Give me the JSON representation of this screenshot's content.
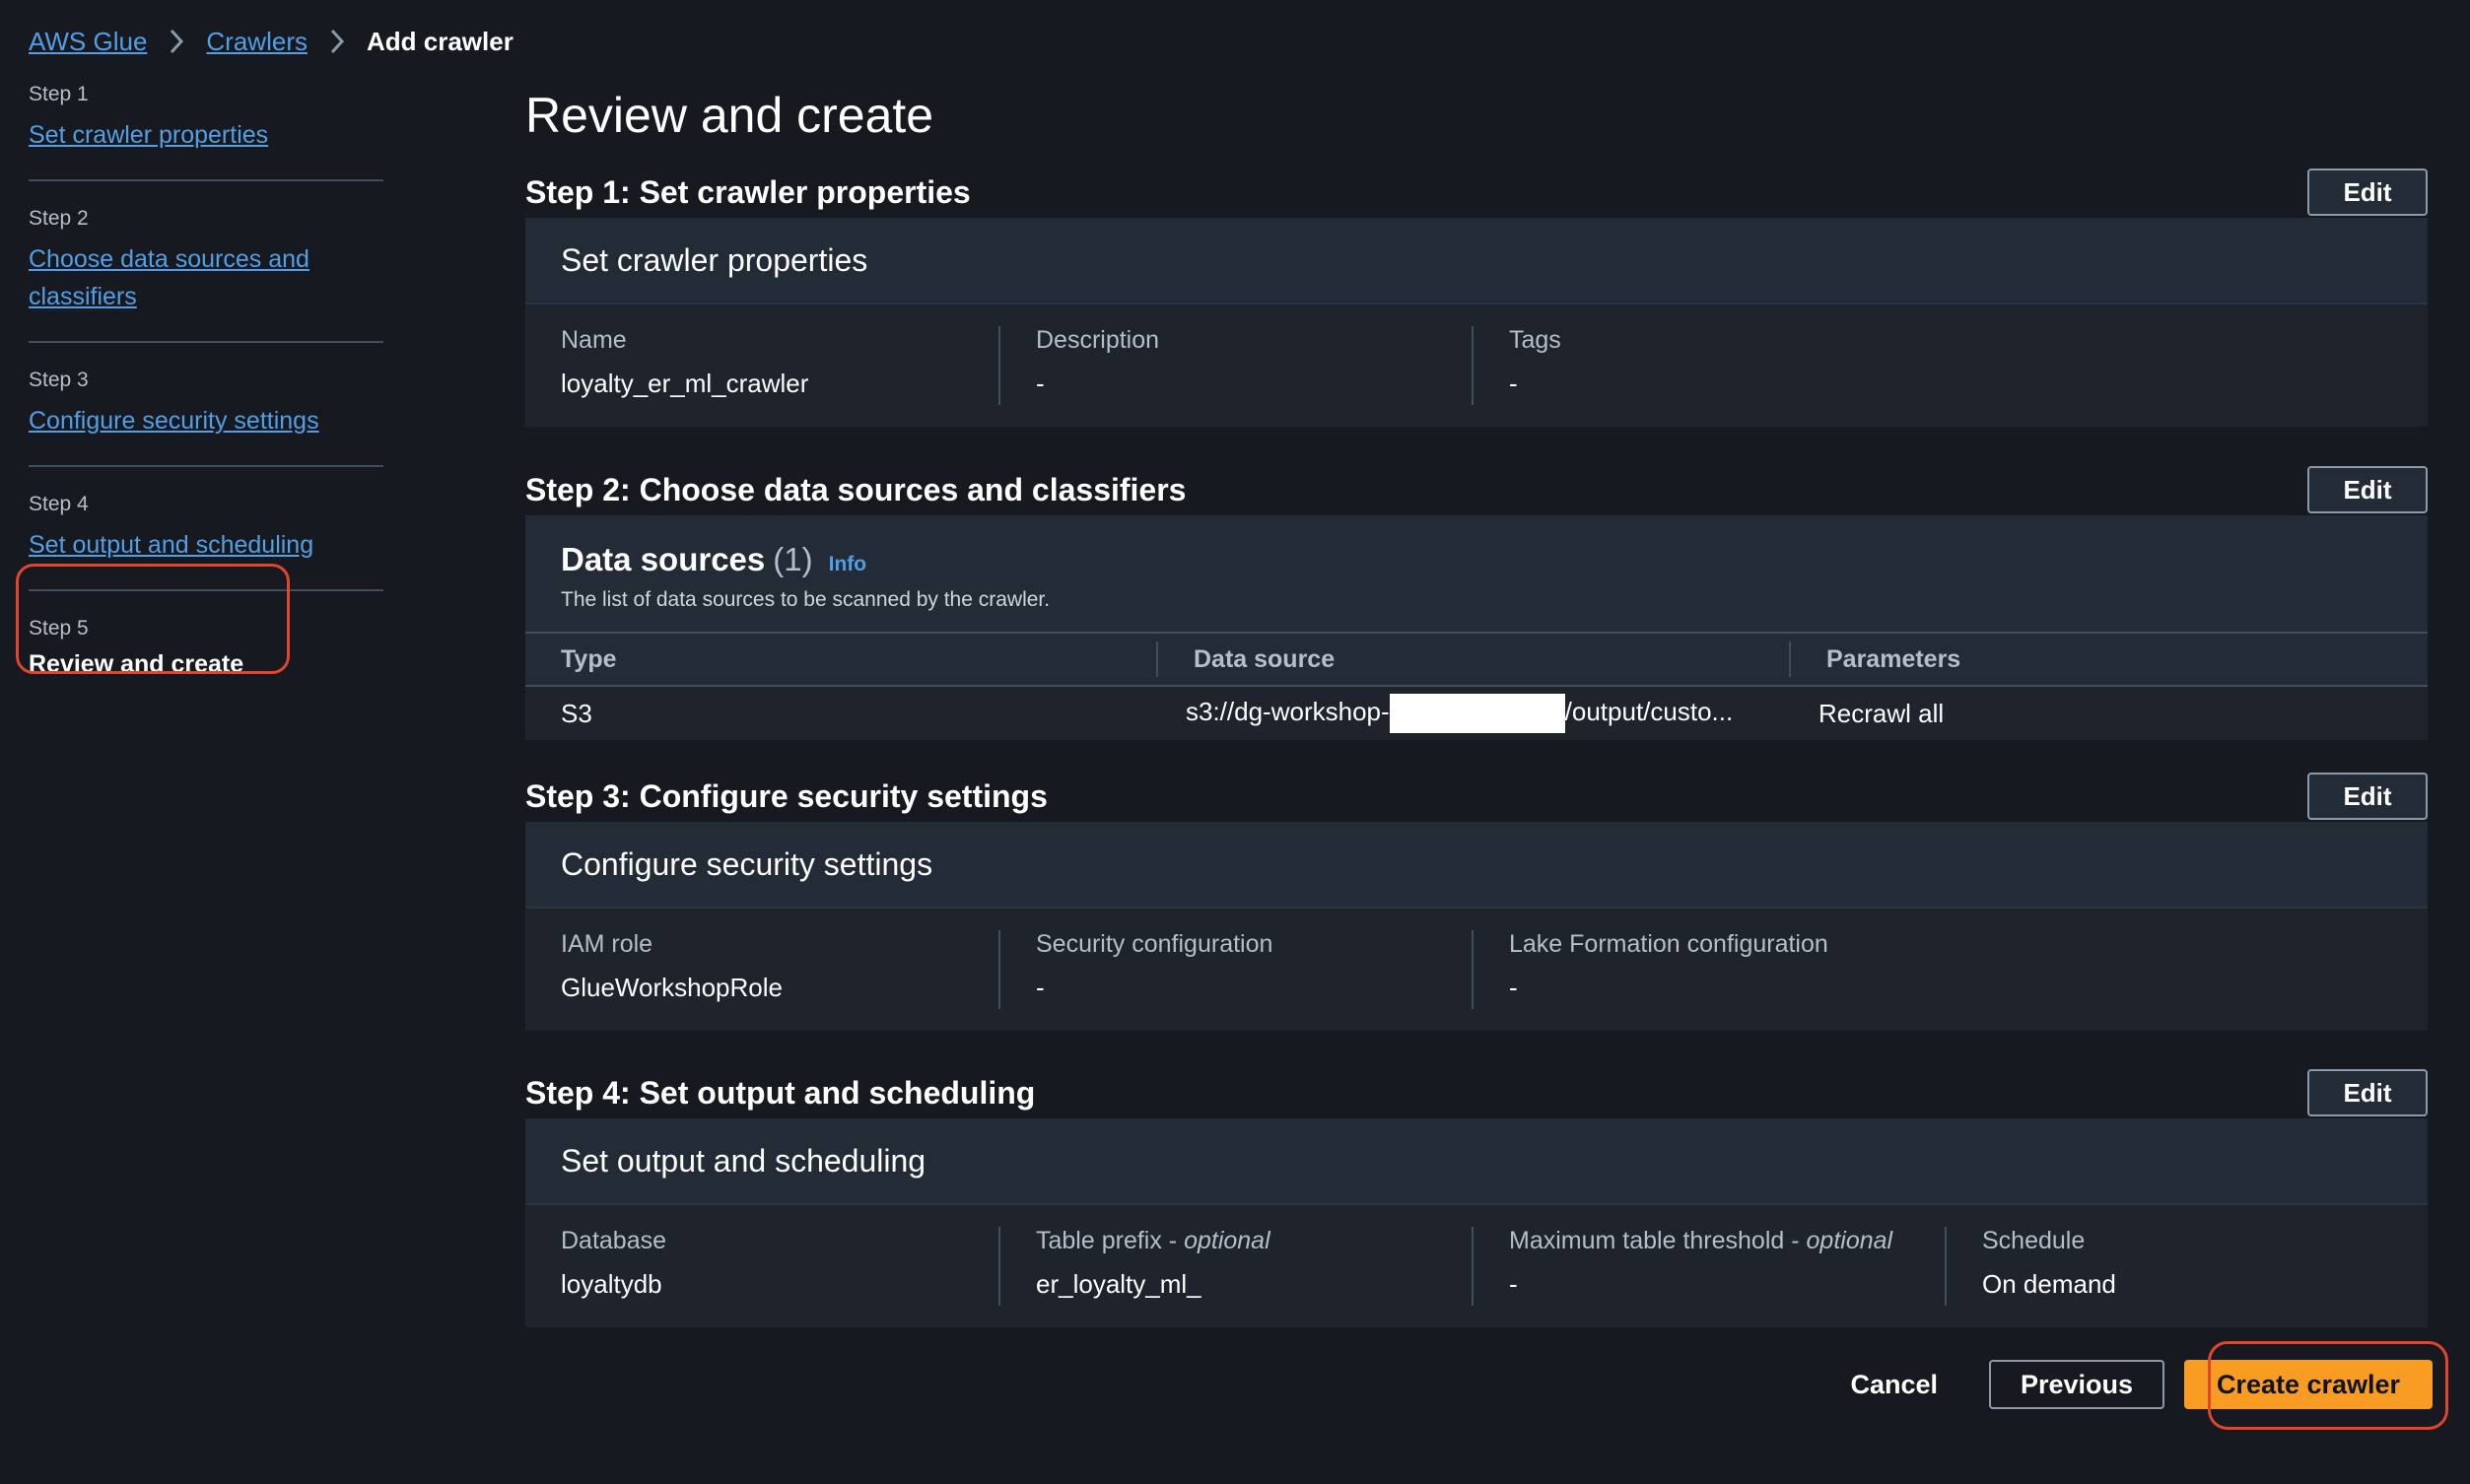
{
  "breadcrumb": {
    "items": [
      "AWS Glue",
      "Crawlers"
    ],
    "current": "Add crawler"
  },
  "sidenav": {
    "steps": [
      {
        "num": "Step 1",
        "label": "Set crawler properties"
      },
      {
        "num": "Step 2",
        "label": "Choose data sources and classifiers"
      },
      {
        "num": "Step 3",
        "label": "Configure security settings"
      },
      {
        "num": "Step 4",
        "label": "Set output and scheduling"
      },
      {
        "num": "Step 5",
        "label": "Review and create"
      }
    ]
  },
  "page": {
    "title": "Review and create"
  },
  "edit_label": "Edit",
  "step1": {
    "header": "Step 1: Set crawler properties",
    "panel_title": "Set crawler properties",
    "fields": [
      {
        "k": "Name",
        "v": "loyalty_er_ml_crawler"
      },
      {
        "k": "Description",
        "v": "-"
      },
      {
        "k": "Tags",
        "v": "-"
      }
    ]
  },
  "step2": {
    "header": "Step 2: Choose data sources and classifiers",
    "title": "Data sources",
    "count": "(1)",
    "info": "Info",
    "desc": "The list of data sources to be scanned by the crawler.",
    "columns": [
      "Type",
      "Data source",
      "Parameters"
    ],
    "rows": [
      {
        "type": "S3",
        "source_prefix": "s3://dg-workshop-",
        "source_suffix": "/output/custo...",
        "params": "Recrawl all"
      }
    ]
  },
  "step3": {
    "header": "Step 3: Configure security settings",
    "panel_title": "Configure security settings",
    "fields": [
      {
        "k": "IAM role",
        "v": "GlueWorkshopRole"
      },
      {
        "k": "Security configuration",
        "v": "-"
      },
      {
        "k": "Lake Formation configuration",
        "v": "-"
      }
    ]
  },
  "step4": {
    "header": "Step 4: Set output and scheduling",
    "panel_title": "Set output and scheduling",
    "fields": [
      {
        "k": "Database",
        "k_opt": "",
        "v": "loyaltydb"
      },
      {
        "k": "Table prefix - ",
        "k_opt": "optional",
        "v": "er_loyalty_ml_"
      },
      {
        "k": "Maximum table threshold - ",
        "k_opt": "optional",
        "v": "-"
      },
      {
        "k": "Schedule",
        "k_opt": "",
        "v": "On demand"
      }
    ]
  },
  "footer": {
    "cancel": "Cancel",
    "previous": "Previous",
    "create": "Create crawler"
  },
  "colors": {
    "accent": "#f89c24",
    "link": "#539fe5",
    "highlight": "#e0452d"
  }
}
